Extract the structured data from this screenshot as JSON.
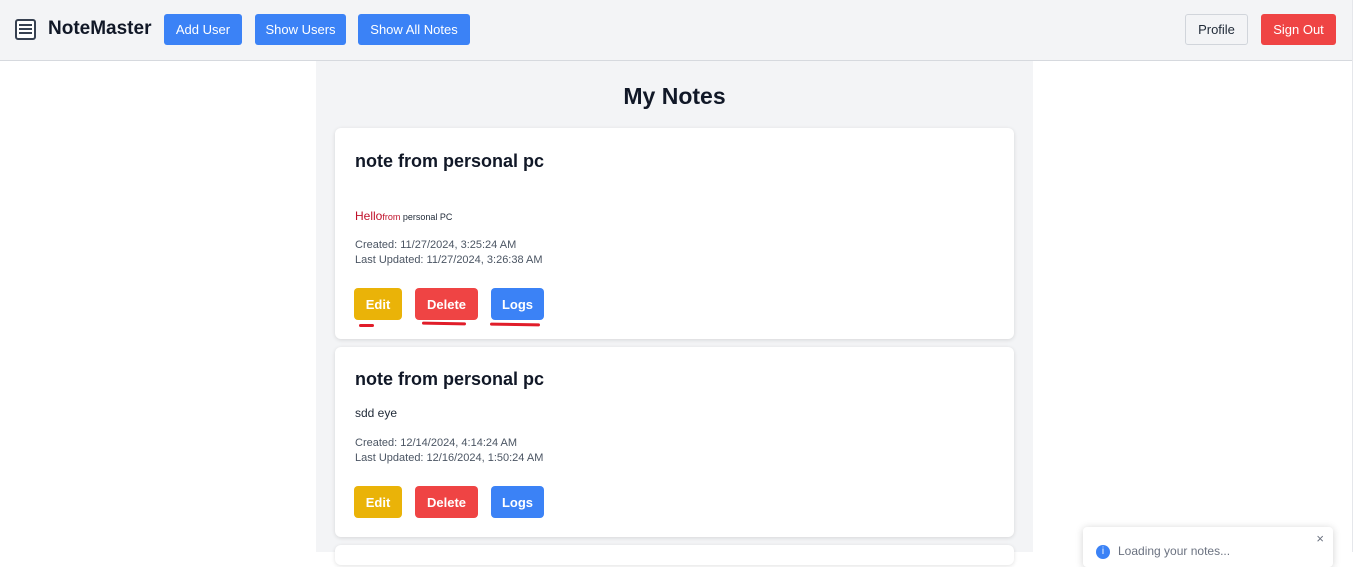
{
  "app": {
    "name": "NoteMaster",
    "icon": "notebook-icon"
  },
  "nav": {
    "add_user": "Add User",
    "show_users": "Show Users",
    "show_all_notes": "Show All Notes",
    "profile": "Profile",
    "sign_out": "Sign Out"
  },
  "page": {
    "title": "My Notes"
  },
  "notes": [
    {
      "title": "note from personal pc",
      "body_hello": "Hello",
      "body_from": "from",
      "body_rest": " personal PC",
      "created": "Created: 11/27/2024, 3:25:24 AM",
      "updated": "Last Updated: 11/27/2024, 3:26:38 AM",
      "edit": "Edit",
      "delete": "Delete",
      "logs": "Logs"
    },
    {
      "title": "note from personal pc",
      "body": "sdd eye",
      "created": "Created: 12/14/2024, 4:14:24 AM",
      "updated": "Last Updated: 12/16/2024, 1:50:24 AM",
      "edit": "Edit",
      "delete": "Delete",
      "logs": "Logs"
    }
  ],
  "toast": {
    "text": "Loading your notes...",
    "close": "×",
    "icon": "info-icon"
  },
  "colors": {
    "primary": "#3b82f6",
    "danger": "#ef4444",
    "warning": "#eab308",
    "annotation": "#e11d2a"
  }
}
